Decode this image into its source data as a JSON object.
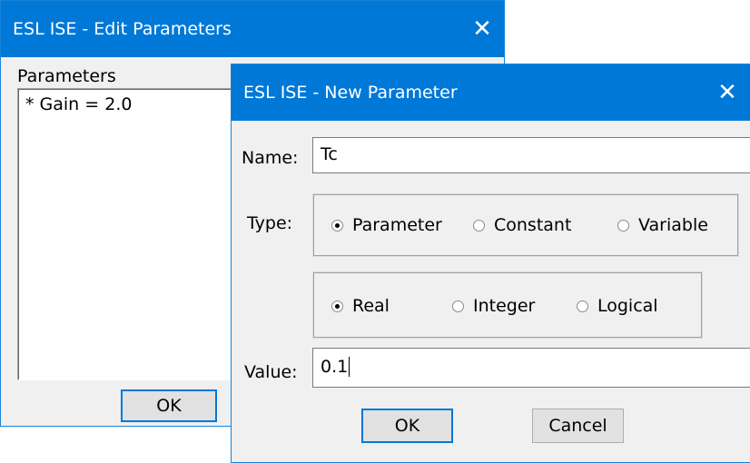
{
  "edit_dialog": {
    "title": "ESL ISE - Edit Parameters",
    "close_glyph": "✕",
    "params_label": "Parameters",
    "params": [
      {
        "text": "* Gain = 2.0"
      }
    ],
    "ok_label": "OK"
  },
  "new_dialog": {
    "title": "ESL ISE - New Parameter",
    "close_glyph": "✕",
    "name_label": "Name:",
    "name_value": "Tc",
    "type_label": "Type:",
    "kind_options": [
      {
        "label": "Parameter",
        "selected": true
      },
      {
        "label": "Constant",
        "selected": false
      },
      {
        "label": "Variable",
        "selected": false
      }
    ],
    "datatype_options": [
      {
        "label": "Real",
        "selected": true
      },
      {
        "label": "Integer",
        "selected": false
      },
      {
        "label": "Logical",
        "selected": false
      }
    ],
    "value_label": "Value:",
    "value": "0.1",
    "ok_label": "OK",
    "cancel_label": "Cancel"
  },
  "colors": {
    "titlebar": "#0078d7",
    "face": "#f0f0f0",
    "button": "#e1e1e1"
  },
  "icons": {
    "close": "close-icon",
    "radio": "radio-icon"
  }
}
